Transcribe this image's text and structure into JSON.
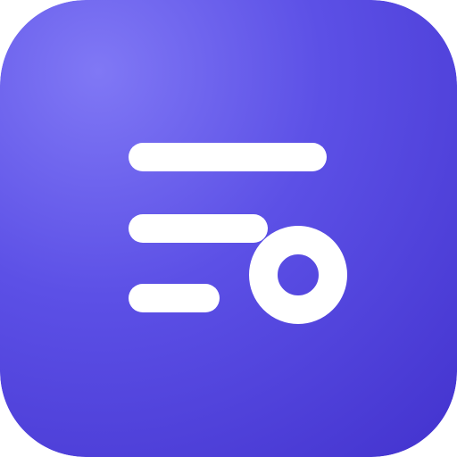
{
  "icon": {
    "name": "list-with-circle-icon",
    "colors": {
      "gradient_light": "#8078F5",
      "gradient_mid": "#5C50E6",
      "gradient_dark": "#4535D0",
      "glyph": "#FFFFFF"
    }
  }
}
